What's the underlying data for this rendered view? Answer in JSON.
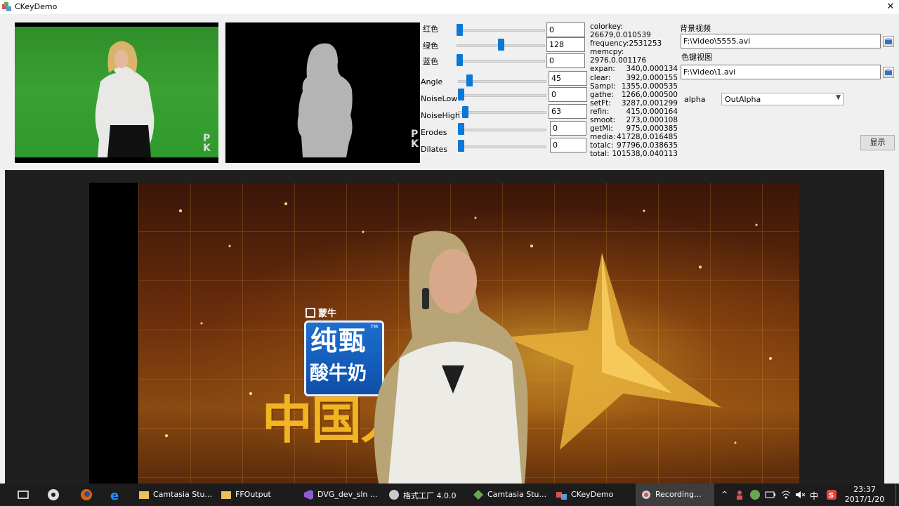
{
  "window": {
    "title": "CKeyDemo",
    "close_glyph": "✕"
  },
  "previews": {
    "source_watermark": "P\nK",
    "mask_watermark": "P\nK"
  },
  "sliders": [
    {
      "label": "红色",
      "value": "0",
      "fraction": 0.0
    },
    {
      "label": "绿色",
      "value": "128",
      "fraction": 0.5
    },
    {
      "label": "蓝色",
      "value": "0",
      "fraction": 0.0
    },
    {
      "label": "Angle",
      "value": "45",
      "fraction": 0.1
    },
    {
      "label": "NoiseLow",
      "value": "0",
      "fraction": 0.0
    },
    {
      "label": "NoiseHigh",
      "value": "63",
      "fraction": 0.05
    },
    {
      "label": "Erodes",
      "value": "0",
      "fraction": 0.0
    },
    {
      "label": "Dilates",
      "value": "0",
      "fraction": 0.0
    }
  ],
  "stats": {
    "colorkey_label": "colorkey:",
    "colorkey_value": "26679,0.010539",
    "frequency": "frequency:2531253",
    "memcpy_label": "memcpy:",
    "memcpy_value": "2976,0.001176",
    "rows": [
      {
        "k": "expan:",
        "v": "340,0.000134"
      },
      {
        "k": "clear:",
        "v": "392,0.000155"
      },
      {
        "k": "Sampl:",
        "v": "1355,0.000535"
      },
      {
        "k": "gathe:",
        "v": "1266,0.000500"
      },
      {
        "k": "setFt:",
        "v": "3287,0.001299"
      },
      {
        "k": "refin:",
        "v": "415,0.000164"
      },
      {
        "k": "smoot:",
        "v": "273,0.000108"
      },
      {
        "k": "getMi:",
        "v": "975,0.000385"
      },
      {
        "k": "media:",
        "v": "41728,0.016485"
      },
      {
        "k": "totalc:",
        "v": "97796,0.038635"
      },
      {
        "k": "total:",
        "v": "101538,0.040113"
      }
    ]
  },
  "files": {
    "bg_label": "背景视频",
    "bg_path": "F:\\Video\\5555.avi",
    "key_label": "色键视图",
    "key_path": "F:\\Video\\1.avi",
    "alpha_label": "alpha",
    "alpha_selected": "OutAlpha",
    "show_button": "显示"
  },
  "output": {
    "logo_text": "蒙牛",
    "card_line1": "纯甄",
    "card_line2": "酸牛奶",
    "card_tm": "TM",
    "big_title": "中国人"
  },
  "taskbar": {
    "items": [
      {
        "label": "Camtasia Stu...",
        "icon": "folder-icon",
        "color": "#e8c15a"
      },
      {
        "label": "FFOutput",
        "icon": "folder-icon",
        "color": "#e8c15a"
      },
      {
        "label": "DVG_dev_sln ...",
        "icon": "visual-studio-icon",
        "color": "#8e5bd1"
      },
      {
        "label": "格式工厂 4.0.0",
        "icon": "format-factory-icon",
        "color": "#c9c9c9"
      },
      {
        "label": "Camtasia Stu...",
        "icon": "camtasia-icon",
        "color": "#6aa84f"
      },
      {
        "label": "CKeyDemo",
        "icon": "app-icon",
        "color": "#d9534f"
      },
      {
        "label": "Recording...",
        "icon": "recording-icon",
        "color": "#cfcfcf"
      }
    ],
    "tray_ime": "中",
    "time": "23:37",
    "date": "2017/1/20"
  },
  "colors": {
    "accent": "#0a78d7",
    "chroma_green": "#3aa133",
    "taskbar": "#1c1c1c"
  }
}
